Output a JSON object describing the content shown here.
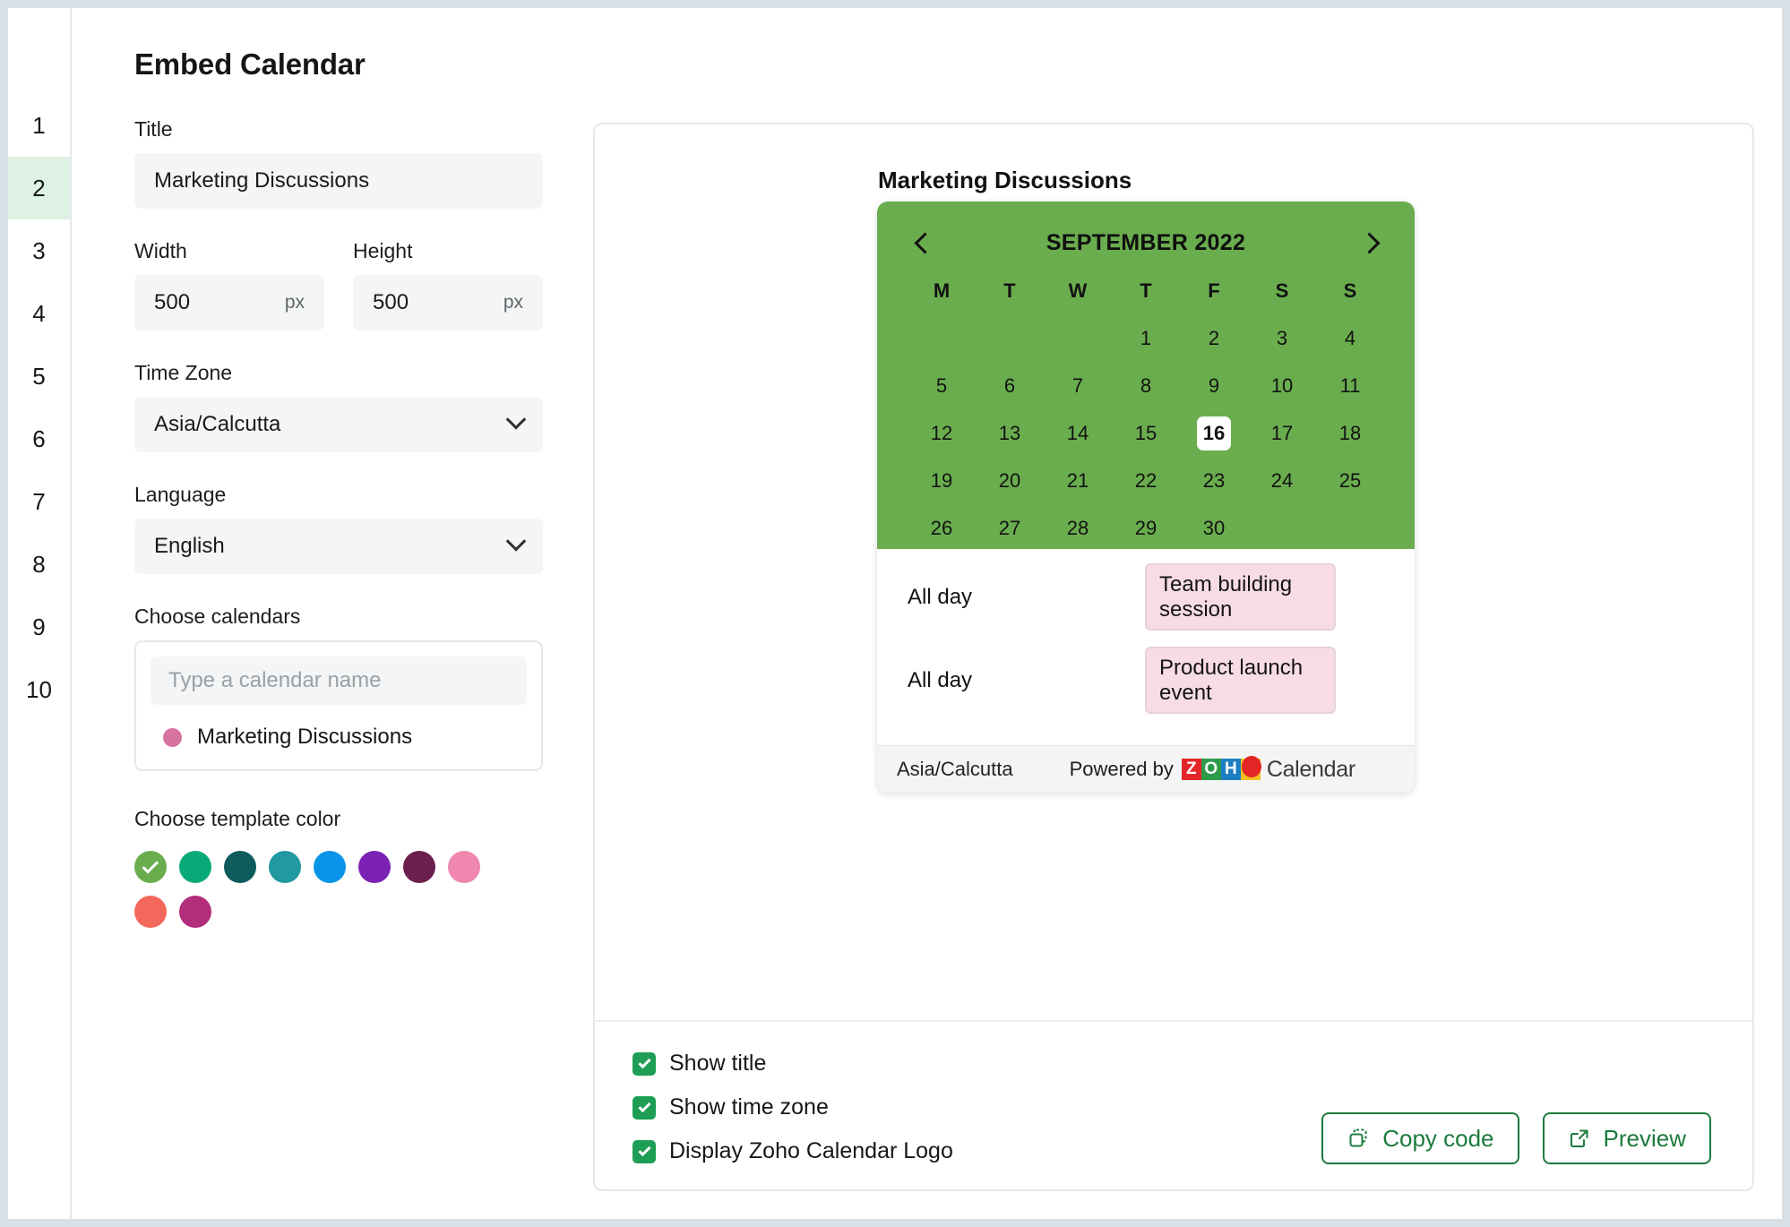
{
  "gutter": {
    "lines": [
      "1",
      "2",
      "3",
      "4",
      "5",
      "6",
      "7",
      "8",
      "9",
      "10"
    ],
    "active_line": "2",
    "active_bg": "#ddf2e4"
  },
  "page": {
    "title": "Embed Calendar"
  },
  "form": {
    "title_label": "Title",
    "title_value": "Marketing Discussions",
    "width_label": "Width",
    "width_value": "500",
    "width_unit": "px",
    "height_label": "Height",
    "height_value": "500",
    "height_unit": "px",
    "timezone_label": "Time Zone",
    "timezone_value": "Asia/Calcutta",
    "language_label": "Language",
    "language_value": "English",
    "calendars_label": "Choose calendars",
    "calendar_search_placeholder": "Type a calendar name",
    "calendar_items": [
      {
        "name": "Marketing Discussions",
        "dot_color": "#d6739e"
      }
    ],
    "template_color_label": "Choose template color",
    "swatches": [
      {
        "color": "#6aad4e",
        "selected": true
      },
      {
        "color": "#0aa97a",
        "selected": false
      },
      {
        "color": "#0d5b5c",
        "selected": false
      },
      {
        "color": "#2099a0",
        "selected": false
      },
      {
        "color": "#0894e8",
        "selected": false
      },
      {
        "color": "#7b22b5",
        "selected": false
      },
      {
        "color": "#6b1f4d",
        "selected": false
      },
      {
        "color": "#f087af",
        "selected": false
      },
      {
        "color": "#f4685c",
        "selected": false
      },
      {
        "color": "#b32d7d",
        "selected": false
      }
    ]
  },
  "preview": {
    "embed_title": "Marketing Discussions",
    "calendar": {
      "month_label": "SEPTEMBER 2022",
      "prev_icon": "chevron-left-icon",
      "next_icon": "chevron-right-icon",
      "header_color": "#6aad4e",
      "weekdays": [
        "M",
        "T",
        "W",
        "T",
        "F",
        "S",
        "S"
      ],
      "leading_blanks": 3,
      "days": [
        "1",
        "2",
        "3",
        "4",
        "5",
        "6",
        "7",
        "8",
        "9",
        "10",
        "11",
        "12",
        "13",
        "14",
        "15",
        "16",
        "17",
        "18",
        "19",
        "20",
        "21",
        "22",
        "23",
        "24",
        "25",
        "26",
        "27",
        "28",
        "29",
        "30"
      ],
      "today": "16",
      "trailing_blanks": 2
    },
    "events": [
      {
        "time": "All day",
        "title": "Team building session"
      },
      {
        "time": "All day",
        "title": "Product launch event"
      }
    ],
    "footer": {
      "timezone": "Asia/Calcutta",
      "powered_by": "Powered by",
      "brand_letters": [
        "Z",
        "O",
        "H",
        "O"
      ],
      "brand_word": "Calendar"
    }
  },
  "options": {
    "checkboxes": [
      {
        "label": "Show title",
        "checked": true
      },
      {
        "label": "Show time zone",
        "checked": true
      },
      {
        "label": "Display Zoho Calendar Logo",
        "checked": true
      }
    ],
    "buttons": [
      {
        "label": "Copy code",
        "icon": "copy-icon"
      },
      {
        "label": "Preview",
        "icon": "external-link-icon"
      }
    ]
  }
}
